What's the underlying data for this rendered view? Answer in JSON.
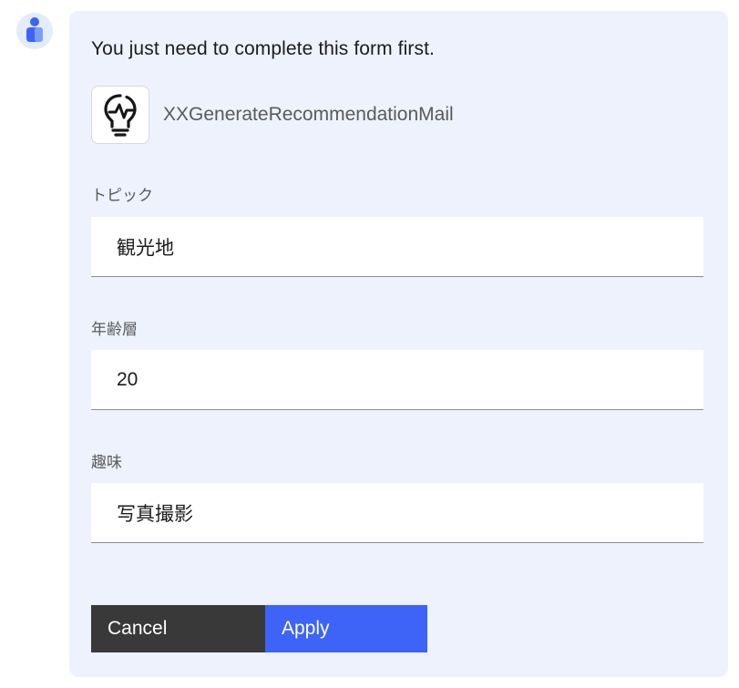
{
  "message": {
    "intro_text": "You just need to complete this form first."
  },
  "tool": {
    "icon": "lightbulb-pulse-icon",
    "name": "XXGenerateRecommendationMail"
  },
  "form": {
    "fields": [
      {
        "label": "トピック",
        "value": "観光地"
      },
      {
        "label": "年齢層",
        "value": "20"
      },
      {
        "label": "趣味",
        "value": "写真撮影"
      }
    ]
  },
  "actions": {
    "cancel_label": "Cancel",
    "apply_label": "Apply"
  },
  "colors": {
    "card_background": "#edf2fd",
    "apply_button": "#3d63f7",
    "cancel_button": "#393939",
    "avatar_background": "#e3ecfb",
    "avatar_icon": "#3d63f7"
  }
}
